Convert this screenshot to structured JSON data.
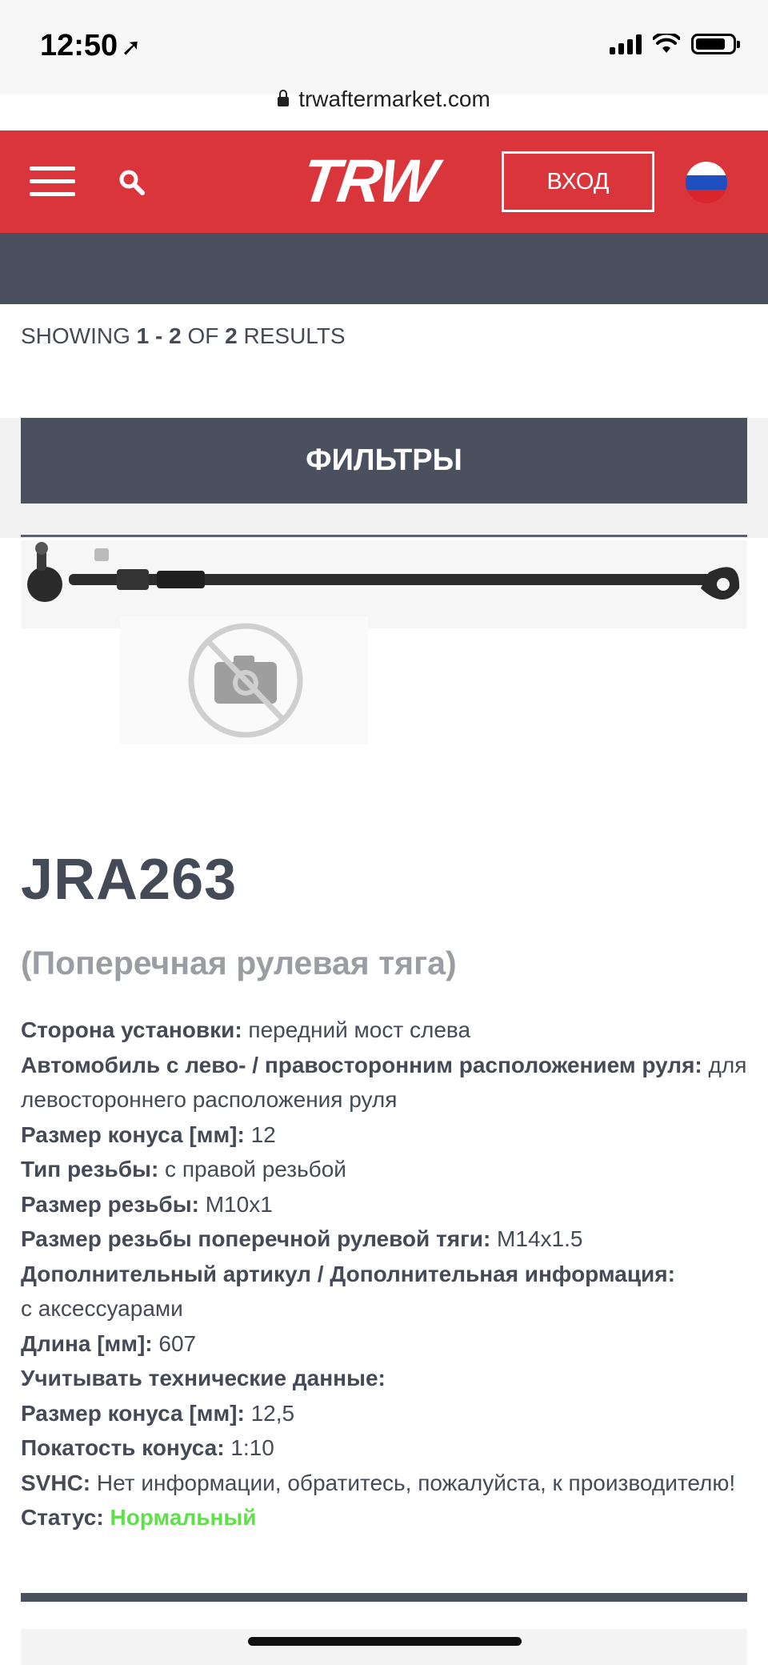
{
  "status_bar": {
    "time": "12:50",
    "location_arrow": "➚"
  },
  "browser": {
    "url": "trwaftermarket.com"
  },
  "header": {
    "logo": "TRW",
    "login_label": "ВХОД",
    "icons": [
      "hamburger-menu-icon",
      "search-icon",
      "russia-flag-icon"
    ],
    "brand_color": "#d9353b"
  },
  "results": {
    "prefix": "SHOWING ",
    "range": "1 - 2",
    "of": " OF ",
    "total": "2",
    "suffix": " RESULTS"
  },
  "filters": {
    "label": "ФИЛЬТРЫ"
  },
  "product": {
    "code": "JRA263",
    "name": "(Поперечная рулевая тяга)",
    "specs": [
      {
        "label": "Сторона установки:",
        "value": " передний мост слева"
      },
      {
        "label": "Автомобиль с лево- / правосторонним расположением руля:",
        "value": " для левостороннего расположения руля"
      },
      {
        "label": "Размер конуса [мм]:",
        "value": " 12"
      },
      {
        "label": "Тип резьбы:",
        "value": " с правой резьбой"
      },
      {
        "label": "Размер резьбы:",
        "value": " M10x1"
      },
      {
        "label": "Размер резьбы поперечной рулевой тяги:",
        "value": " M14x1.5"
      },
      {
        "label": "Дополнительный артикул / Дополнительная информация:",
        "value": " с аксессуарами"
      },
      {
        "label": "Длина [мм]:",
        "value": " 607"
      },
      {
        "label": "Учитывать технические данные:",
        "value": ""
      },
      {
        "label": "Размер конуса [мм]:",
        "value": " 12,5"
      },
      {
        "label": "Покатость конуса:",
        "value": " 1:10"
      },
      {
        "label": "SVHC:",
        "value": " Нет информации, обратитесь, пожалуйста, к производителю!"
      }
    ],
    "status_label": "Статус:",
    "status_value": "Нормальный",
    "status_color": "#5fe04a"
  }
}
